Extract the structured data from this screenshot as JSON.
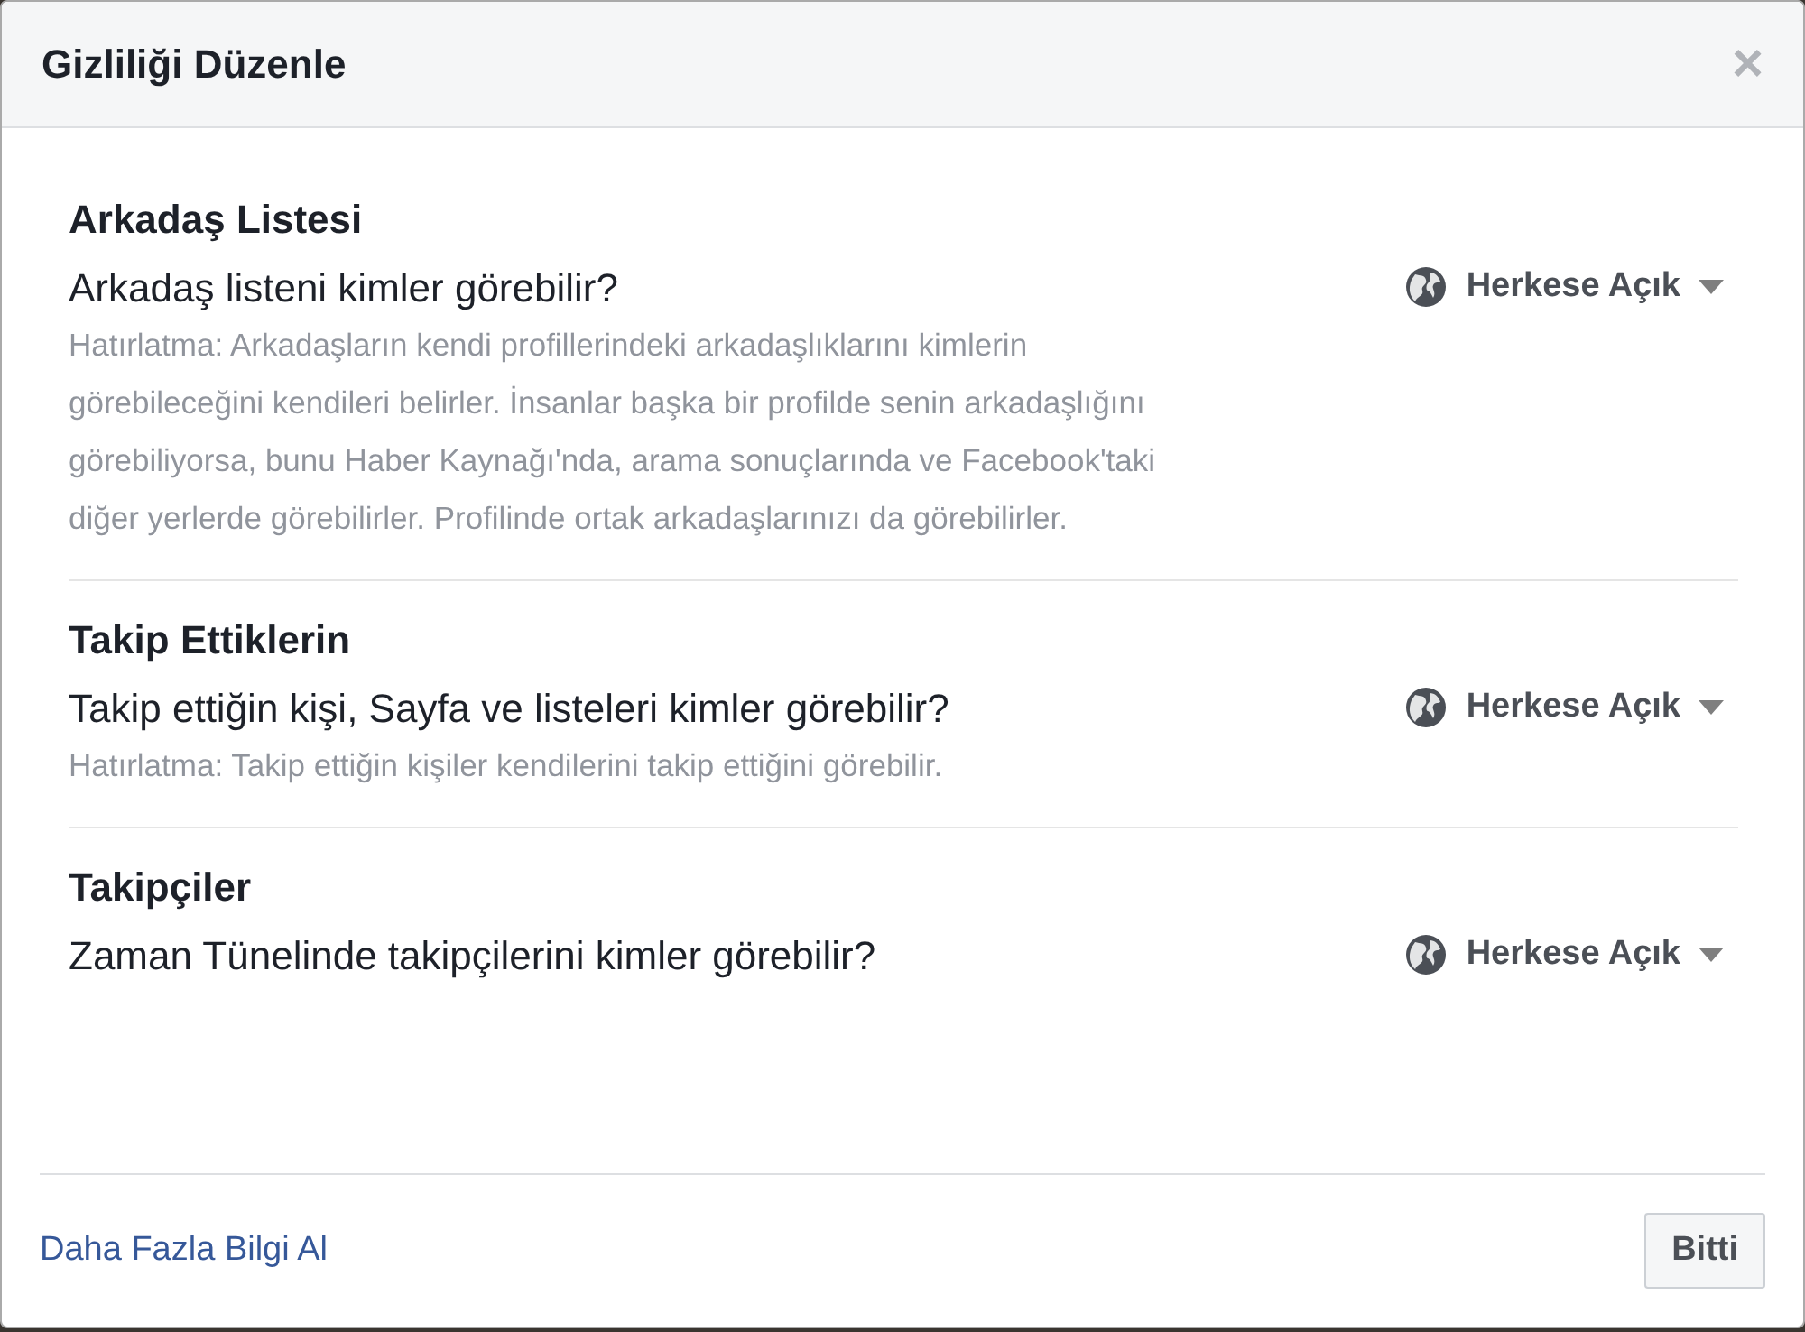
{
  "dialog": {
    "title": "Gizliliği Düzenle",
    "close": "×"
  },
  "sections": [
    {
      "heading": "Arkadaş Listesi",
      "question": "Arkadaş listeni kimler görebilir?",
      "note": "Hatırlatma: Arkadaşların kendi profillerindeki arkadaşlıklarını kimlerin görebileceğini kendileri belirler. İnsanlar başka bir profilde senin arkadaşlığını görebiliyorsa, bunu Haber Kaynağı'nda, arama sonuçlarında ve Facebook'taki diğer yerlerde görebilirler. Profilinde ortak arkadaşlarınızı da görebilirler.",
      "audience": "Herkese Açık"
    },
    {
      "heading": "Takip Ettiklerin",
      "question": "Takip ettiğin kişi, Sayfa ve listeleri kimler görebilir?",
      "note": "Hatırlatma: Takip ettiğin kişiler kendilerini takip ettiğini görebilir.",
      "audience": "Herkese Açık"
    },
    {
      "heading": "Takipçiler",
      "question": "Zaman Tünelinde takipçilerini kimler görebilir?",
      "audience": "Herkese Açık"
    }
  ],
  "footer": {
    "link": "Daha Fazla Bilgi Al",
    "button": "Bitti"
  }
}
